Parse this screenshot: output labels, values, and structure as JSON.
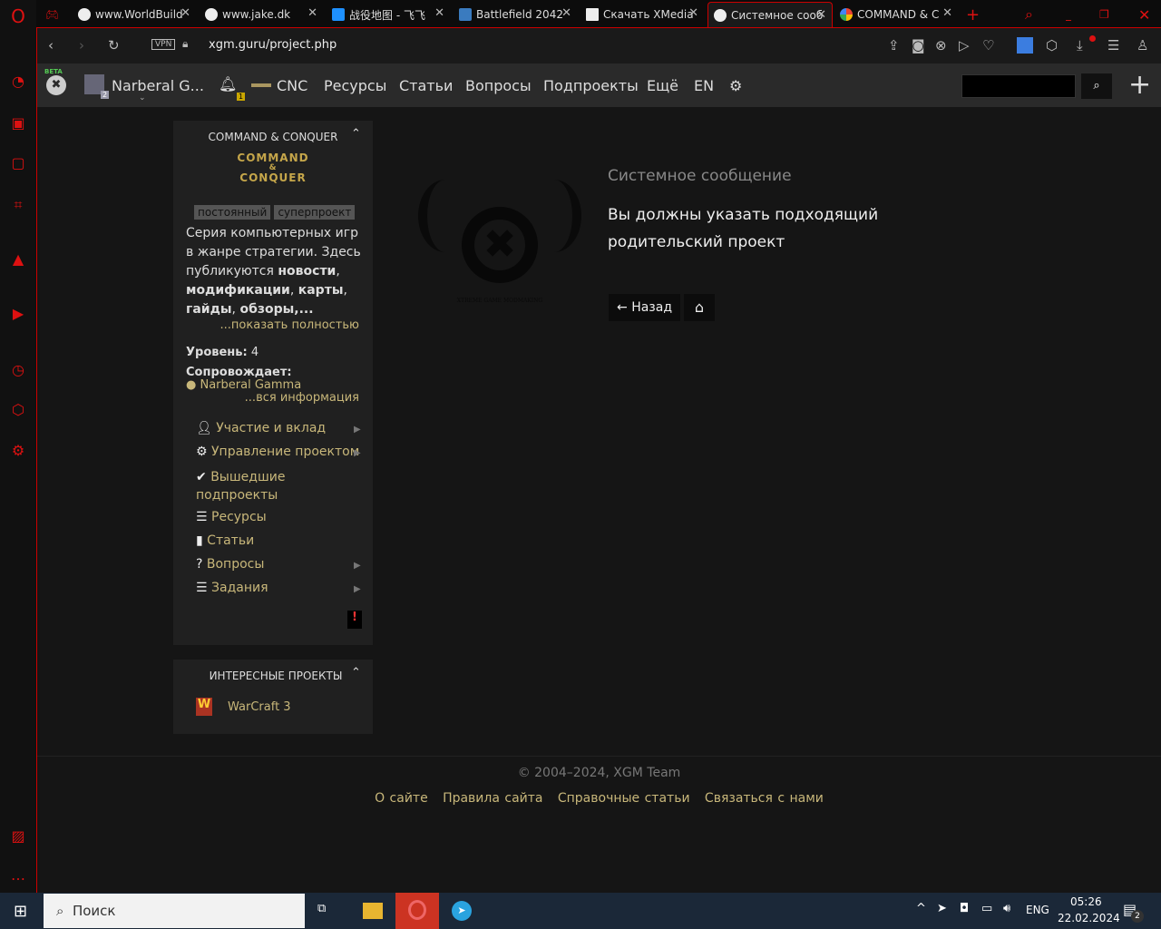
{
  "browser": {
    "tabs": [
      {
        "title": "www.WorldBuild",
        "active": false
      },
      {
        "title": "www.jake.dk",
        "active": false
      },
      {
        "title": "战役地图 - 飞飞",
        "active": false
      },
      {
        "title": "Battlefield 2042",
        "active": false
      },
      {
        "title": "Скачать XMedia",
        "active": false
      },
      {
        "title": "Системное сооб",
        "active": true
      },
      {
        "title": "COMMAND & C",
        "active": false
      }
    ],
    "vpn_label": "VPN",
    "url": "xgm.guru/project.php"
  },
  "site_nav": {
    "beta": "BETA",
    "user": "Narberal G...",
    "user_badge": "2",
    "notif_badge": "1",
    "items": [
      "CNC",
      "Ресурсы",
      "Статьи",
      "Вопросы",
      "Подпроекты",
      "Ещё",
      "EN"
    ]
  },
  "project_panel": {
    "title": "COMMAND & CONQUER",
    "logo_text": [
      "COMMAND",
      "&",
      "CONQUER"
    ],
    "tags": [
      "постоянный",
      "суперпроект"
    ],
    "desc_plain": "Серия компьютерных игр в жанре стратегии. Здесь публикуются ",
    "desc_bold1": "новости",
    "desc_bold2": "модификации",
    "desc_bold3": "карты",
    "desc_bold4": "гайды",
    "desc_bold5": "обзоры",
    "show_more": "...показать полностью",
    "level_label": "Уровень:",
    "level": "4",
    "maintainer_label": "Сопровождает:",
    "maintainer": "Narberal Gamma",
    "all_info": "...вся информация",
    "menu": [
      "Участие и вклад",
      "Управление проектом",
      "Вышедшие подпроекты",
      "Ресурсы",
      "Статьи",
      "Вопросы",
      "Задания"
    ],
    "alert": "!"
  },
  "interesting_panel": {
    "title": "ИНТЕРЕСНЫЕ ПРОЕКТЫ",
    "items": [
      "WarCraft 3"
    ]
  },
  "message": {
    "heading": "Системное сообщение",
    "text": "Вы должны указать подходящий родительский проект",
    "back": "Назад",
    "logo_caption": "XTREME GAME MODMAKING"
  },
  "footer": {
    "copyright": "© 2004–2024, XGM Team",
    "links": [
      "О сайте",
      "Правила сайта",
      "Справочные статьи",
      "Связаться с нами"
    ]
  },
  "taskbar": {
    "search": "Поиск",
    "lang": "ENG",
    "time": "05:26",
    "date": "22.02.2024",
    "notif_count": "2"
  }
}
